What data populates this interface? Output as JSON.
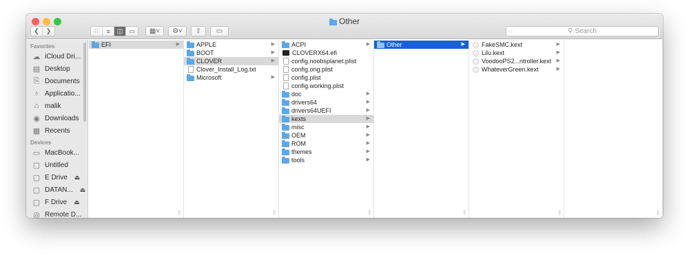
{
  "window": {
    "title": "Other",
    "traffic_colors": [
      "#fc605c",
      "#fdbc40",
      "#34c84a"
    ]
  },
  "toolbar": {
    "back_icon": "chevron-left-icon",
    "forward_icon": "chevron-right-icon",
    "view_icons": [
      "icon-view-icon",
      "list-view-icon",
      "column-view-icon",
      "cover-flow-icon"
    ],
    "active_view_index": 2,
    "arrange_icon": "arrange-icon",
    "action_icon": "gear-icon",
    "share_icon": "share-icon",
    "tags_icon": "tag-icon",
    "search_placeholder": "Search"
  },
  "sidebar": {
    "favorites_header": "Favorites",
    "favorites": [
      {
        "label": "iCloud Dri...",
        "icon": "cloud-icon"
      },
      {
        "label": "Desktop",
        "icon": "desktop-icon"
      },
      {
        "label": "Documents",
        "icon": "documents-icon"
      },
      {
        "label": "Applicatio...",
        "icon": "applications-icon"
      },
      {
        "label": "malik",
        "icon": "home-icon"
      },
      {
        "label": "Downloads",
        "icon": "downloads-icon"
      },
      {
        "label": "Recents",
        "icon": "recents-icon"
      }
    ],
    "devices_header": "Devices",
    "devices": [
      {
        "label": "MacBook...",
        "icon": "laptop-icon",
        "eject": false
      },
      {
        "label": "Untitled",
        "icon": "drive-icon",
        "eject": false
      },
      {
        "label": "E Drive",
        "icon": "drive-icon",
        "eject": true
      },
      {
        "label": "DATAN...",
        "icon": "drive-icon",
        "eject": true
      },
      {
        "label": "F Drive",
        "icon": "drive-icon",
        "eject": true
      },
      {
        "label": "Remote D...",
        "icon": "remote-disc-icon",
        "eject": false
      }
    ],
    "eject_glyph": "⏏"
  },
  "columns": [
    {
      "items": [
        {
          "name": "EFI",
          "type": "folder",
          "has_children": true,
          "selected": "grey"
        }
      ]
    },
    {
      "items": [
        {
          "name": "APPLE",
          "type": "folder",
          "has_children": true,
          "selected": ""
        },
        {
          "name": "BOOT",
          "type": "folder",
          "has_children": true,
          "selected": ""
        },
        {
          "name": "CLOVER",
          "type": "folder",
          "has_children": true,
          "selected": "grey"
        },
        {
          "name": "Clover_Install_Log.txt",
          "type": "doc",
          "has_children": false,
          "selected": ""
        },
        {
          "name": "Microsoft",
          "type": "folder",
          "has_children": true,
          "selected": ""
        }
      ]
    },
    {
      "items": [
        {
          "name": "ACPI",
          "type": "folder",
          "has_children": true,
          "selected": ""
        },
        {
          "name": "CLOVERX64.efi",
          "type": "exe",
          "has_children": false,
          "selected": ""
        },
        {
          "name": "config.noobsplanet.plist",
          "type": "doc",
          "has_children": false,
          "selected": ""
        },
        {
          "name": "config.orig.plist",
          "type": "doc",
          "has_children": false,
          "selected": ""
        },
        {
          "name": "config.plist",
          "type": "doc",
          "has_children": false,
          "selected": ""
        },
        {
          "name": "config.working.plist",
          "type": "doc",
          "has_children": false,
          "selected": ""
        },
        {
          "name": "doc",
          "type": "folder",
          "has_children": true,
          "selected": ""
        },
        {
          "name": "drivers64",
          "type": "folder",
          "has_children": true,
          "selected": ""
        },
        {
          "name": "drivers64UEFI",
          "type": "folder",
          "has_children": true,
          "selected": ""
        },
        {
          "name": "kexts",
          "type": "folder",
          "has_children": true,
          "selected": "grey"
        },
        {
          "name": "misc",
          "type": "folder",
          "has_children": true,
          "selected": ""
        },
        {
          "name": "OEM",
          "type": "folder",
          "has_children": true,
          "selected": ""
        },
        {
          "name": "ROM",
          "type": "folder",
          "has_children": true,
          "selected": ""
        },
        {
          "name": "themes",
          "type": "folder",
          "has_children": true,
          "selected": ""
        },
        {
          "name": "tools",
          "type": "folder",
          "has_children": true,
          "selected": ""
        }
      ]
    },
    {
      "items": [
        {
          "name": "Other",
          "type": "folder",
          "has_children": true,
          "selected": "blue"
        }
      ]
    },
    {
      "items": [
        {
          "name": "FakeSMC.kext",
          "type": "kext",
          "has_children": true,
          "selected": ""
        },
        {
          "name": "Lilu.kext",
          "type": "kext",
          "has_children": true,
          "selected": ""
        },
        {
          "name": "VoodooPS2...ntroller.kext",
          "type": "kext",
          "has_children": true,
          "selected": ""
        },
        {
          "name": "WhateverGreen.kext",
          "type": "kext",
          "has_children": true,
          "selected": ""
        }
      ]
    },
    {
      "items": []
    }
  ],
  "glyphs": {
    "disclosure": "▶",
    "column_resize": "||"
  },
  "colors": {
    "selection_blue": "#1761d6",
    "selection_grey": "#d9d9d9",
    "folder": "#5aa8e8"
  }
}
